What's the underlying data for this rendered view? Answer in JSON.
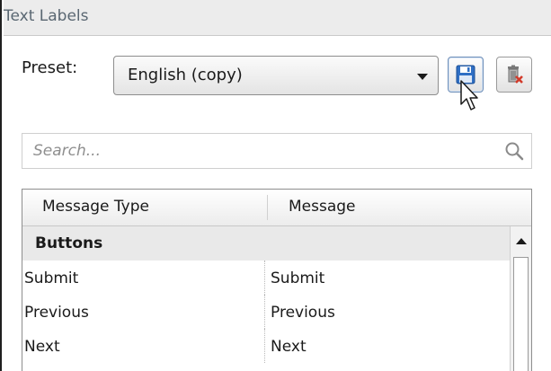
{
  "panel": {
    "title": "Text Labels"
  },
  "preset": {
    "label": "Preset:",
    "selected": "English (copy)",
    "save_icon": "floppy-disk-icon",
    "delete_icon": "delete-icon"
  },
  "search": {
    "placeholder": "Search...",
    "icon": "search-icon"
  },
  "grid": {
    "columns": [
      "Message Type",
      "Message"
    ],
    "groups": [
      {
        "name": "Buttons",
        "rows": [
          {
            "type": "Submit",
            "message": "Submit"
          },
          {
            "type": "Previous",
            "message": "Previous"
          },
          {
            "type": "Next",
            "message": "Next"
          }
        ]
      }
    ]
  },
  "colors": {
    "title_bar": "#ececec",
    "group_row": "#e9e9e9",
    "save_accent": "#2f6fc4",
    "delete_accent": "#d23a2a"
  }
}
